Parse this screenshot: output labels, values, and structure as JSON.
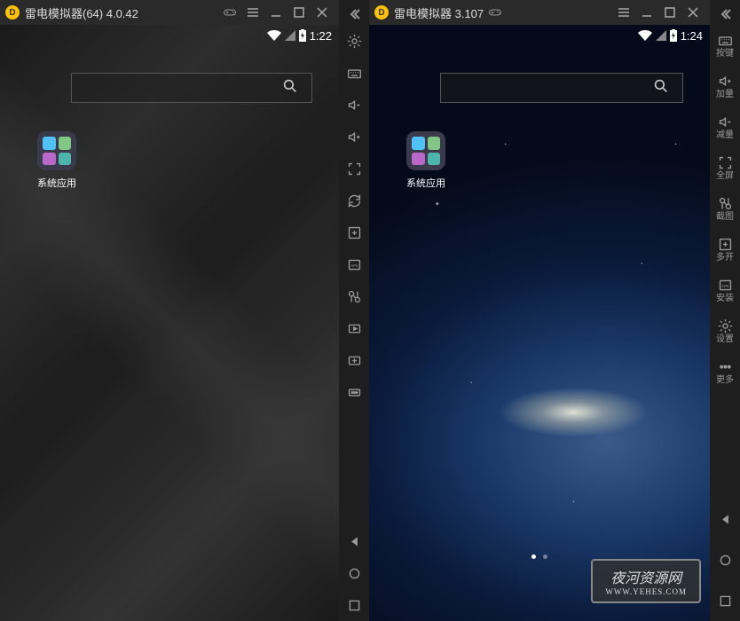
{
  "left": {
    "title": "雷电模拟器(64) 4.0.42",
    "statusTime": "1:22",
    "appLabel": "系统应用"
  },
  "right": {
    "title": "雷电模拟器 3.107",
    "statusTime": "1:24",
    "appLabel": "系统应用",
    "watermarkTitle": "夜河资源网",
    "watermarkUrl": "WWW.YEHES.COM"
  },
  "sidebarLabels": {
    "keymap": "按键",
    "volUp": "加量",
    "volDown": "减量",
    "fullscreen": "全屏",
    "screenshot": "截图",
    "multi": "多开",
    "install": "安装",
    "settings": "设置",
    "more": "更多"
  }
}
